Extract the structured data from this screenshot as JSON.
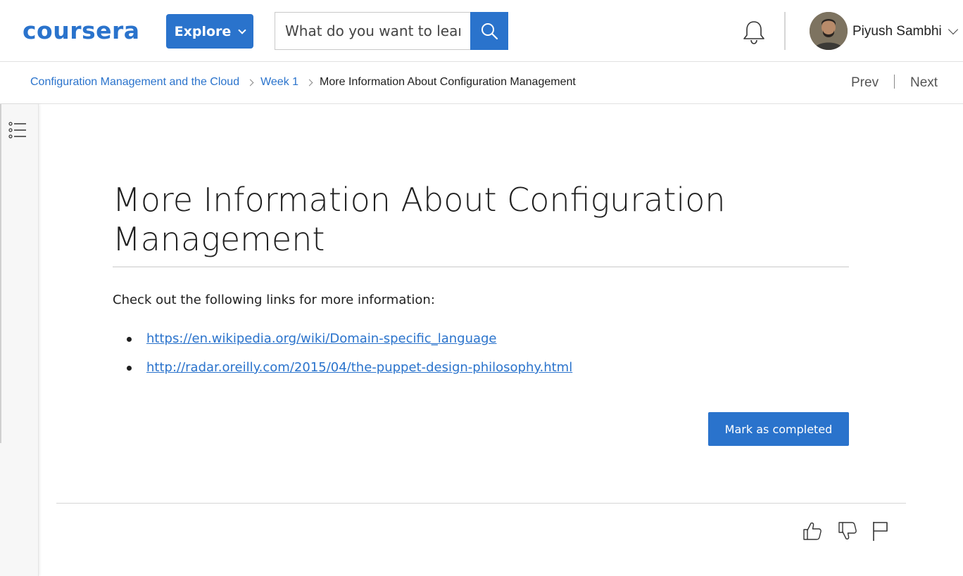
{
  "header": {
    "logo_text": "coursera",
    "explore_label": "Explore",
    "search_placeholder": "What do you want to learn?",
    "user_name": "Piyush Sambhi",
    "brand_color": "#2a73cc"
  },
  "breadcrumb": {
    "items": [
      "Configuration Management and the Cloud",
      "Week 1",
      "More Information About Configuration Management"
    ],
    "prev_label": "Prev",
    "next_label": "Next"
  },
  "content": {
    "title": "More Information About Configuration Management",
    "intro": "Check out the following links for more information:",
    "links": [
      "https://en.wikipedia.org/wiki/Domain-specific_language",
      "http://radar.oreilly.com/2015/04/the-puppet-design-philosophy.html"
    ],
    "mark_completed_label": "Mark as completed"
  },
  "icons": {
    "search": "search-icon",
    "notifications": "bell-icon",
    "outline": "list-icon",
    "like": "thumbs-up-icon",
    "dislike": "thumbs-down-icon",
    "report": "flag-icon"
  }
}
